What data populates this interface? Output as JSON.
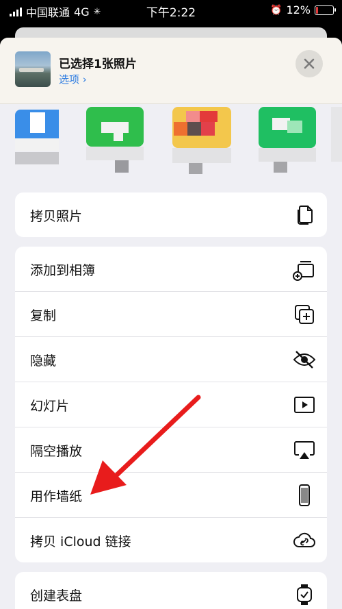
{
  "status_bar": {
    "carrier": "中国联通",
    "network": "4G",
    "time": "下午2:22",
    "battery": "12%"
  },
  "share_header": {
    "title": "已选择1张照片",
    "options_link": "选项 ›"
  },
  "actions": {
    "group1": [
      {
        "label": "拷贝照片",
        "icon": "copy-photo-icon"
      }
    ],
    "group2": [
      {
        "label": "添加到相簿",
        "icon": "add-to-album-icon"
      },
      {
        "label": "复制",
        "icon": "duplicate-icon"
      },
      {
        "label": "隐藏",
        "icon": "hide-eye-icon"
      },
      {
        "label": "幻灯片",
        "icon": "slideshow-play-icon"
      },
      {
        "label": "隔空播放",
        "icon": "airplay-icon"
      },
      {
        "label": "用作墙纸",
        "icon": "phone-wallpaper-icon"
      },
      {
        "label": "拷贝 iCloud 链接",
        "icon": "icloud-link-icon"
      }
    ],
    "group3": [
      {
        "label": "创建表盘",
        "icon": "watch-face-icon"
      }
    ]
  },
  "colors": {
    "accent": "#2f7de1",
    "annotation_arrow": "#e81c1c",
    "sheet_bg": "#efeff4"
  }
}
